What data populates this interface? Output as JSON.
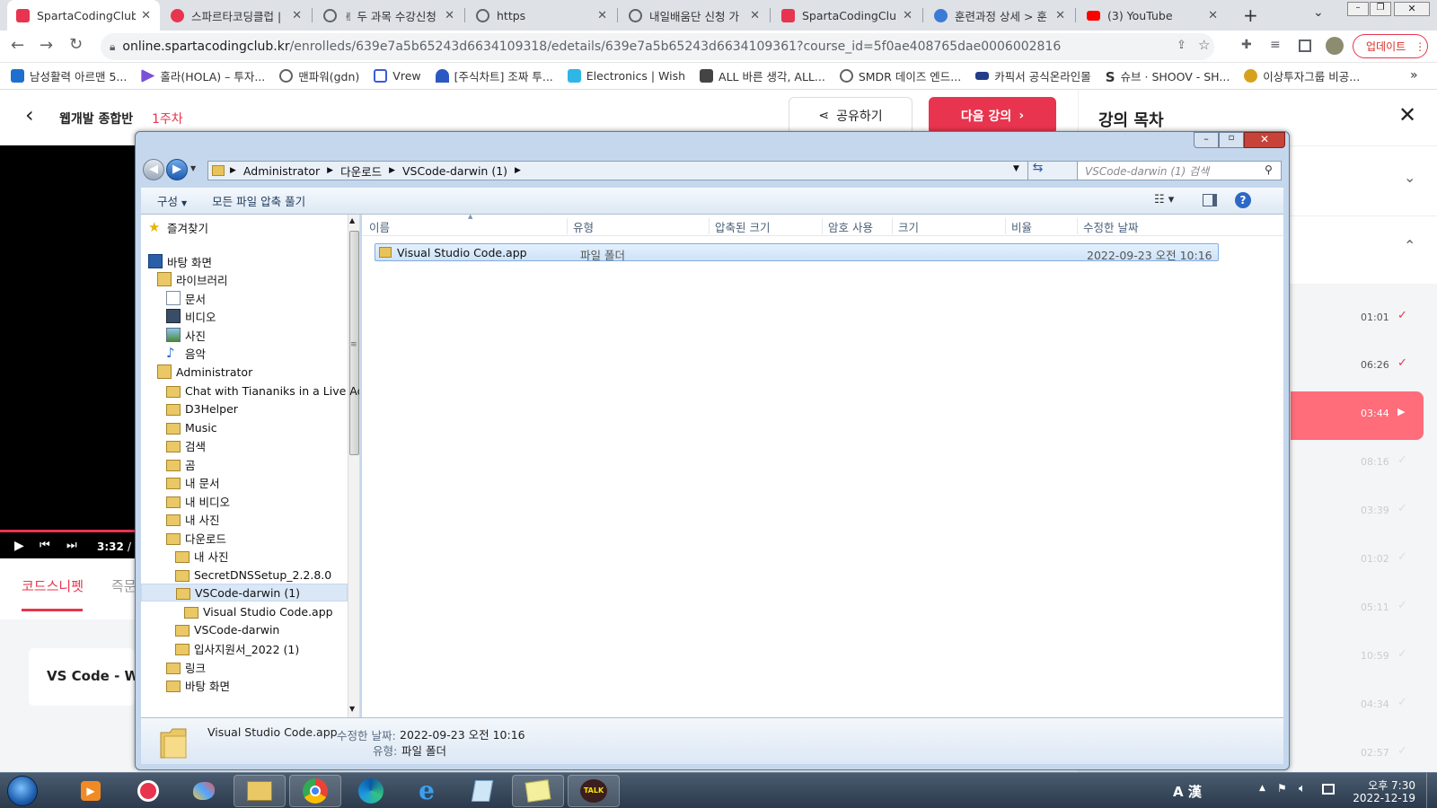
{
  "browser": {
    "tabs": [
      {
        "title": "SpartaCodingClub",
        "favicon_color": "#e8344e",
        "active": true
      },
      {
        "title": "스파르타코딩클럽 |",
        "favicon_color": "#e8344e"
      },
      {
        "title": "✌ 두 과목 수강신청",
        "favicon_color": "#5f6368"
      },
      {
        "title": "https",
        "favicon_color": "#5f6368"
      },
      {
        "title": "내일배움단 신청 가",
        "favicon_color": "#5f6368"
      },
      {
        "title": "SpartaCodingClub",
        "favicon_color": "#e8344e"
      },
      {
        "title": "훈련과정 상세 > 훈",
        "favicon_color": "#3a7bd5"
      },
      {
        "title": "(3) YouTube",
        "favicon_color": "#ff0000"
      }
    ],
    "new_tab_label": "+",
    "url_domain": "online.spartacodingclub.kr",
    "url_path": "/enrolleds/639e7a5b65243d6634109318/edetails/639e7a5b65243d6634109361?course_id=5f0ae408765dae0006002816",
    "update_label": "업데이트",
    "bookmarks": [
      {
        "label": "남성활력 아르맨 5...",
        "color": "#1f6fd1"
      },
      {
        "label": "홀라(HOLA) – 투자...",
        "color": "#7b4fd8"
      },
      {
        "label": "맨파워(gdn)",
        "color": "#5f6368"
      },
      {
        "label": "Vrew",
        "color": "#3b5bdb"
      },
      {
        "label": "[주식차트] 조짜 투...",
        "color": "#2b59c3"
      },
      {
        "label": "Electronics | Wish",
        "color": "#2fb5e6"
      },
      {
        "label": "ALL 바른 생각, ALL...",
        "color": "#444444"
      },
      {
        "label": "SMDR 데이즈 엔드...",
        "color": "#5f6368"
      },
      {
        "label": "카픽서 공식온라인몰",
        "color": "#233d8a"
      },
      {
        "label": "슈브 · SHOOV - SH...",
        "color": "#111111"
      },
      {
        "label": "이상투자그룹 비공...",
        "color": "#d6a21e"
      }
    ],
    "bookmarks_more": "»"
  },
  "web": {
    "course_title": "웹개발 종합반",
    "week": "1주차",
    "share_label": "공유하기",
    "next_label": "다음 강의",
    "toc_title": "강의 목차",
    "player_time": "3:32",
    "player_sep": "/",
    "tab_snippet": "코드스니펫",
    "tab_question": "즉문",
    "card_title": "VS Code - Wi",
    "lecture_times": [
      "01:01",
      "06:26",
      "03:44",
      "08:16",
      "03:39",
      "01:02",
      "05:11",
      "10:59",
      "04:34",
      "02:57"
    ],
    "accent": "#e8344e"
  },
  "explorer": {
    "breadcrumb": [
      "Administrator",
      "다운로드",
      "VSCode-darwin (1)"
    ],
    "search_placeholder": "VSCode-darwin (1) 검색",
    "organize_label": "구성",
    "extract_label": "모든 파일 압축 풀기",
    "nav_items": [
      {
        "label": "즐겨찾기",
        "icon": "star-icon"
      },
      {
        "label": "바탕 화면",
        "icon": "desktop-icon"
      },
      {
        "label": "라이브러리",
        "icon": "library-icon"
      },
      {
        "label": "문서",
        "icon": "document-icon"
      },
      {
        "label": "비디오",
        "icon": "video-icon"
      },
      {
        "label": "사진",
        "icon": "picture-icon"
      },
      {
        "label": "음악",
        "icon": "music-icon"
      },
      {
        "label": "Administrator",
        "icon": "user-folder-icon"
      },
      {
        "label": "Chat with Tiananiks in a Live Adi",
        "icon": "folder-icon"
      },
      {
        "label": "D3Helper",
        "icon": "folder-icon"
      },
      {
        "label": "Music",
        "icon": "folder-icon"
      },
      {
        "label": "검색",
        "icon": "folder-icon"
      },
      {
        "label": "곰",
        "icon": "folder-icon"
      },
      {
        "label": "내 문서",
        "icon": "folder-icon"
      },
      {
        "label": "내 비디오",
        "icon": "folder-icon"
      },
      {
        "label": "내 사진",
        "icon": "folder-icon"
      },
      {
        "label": "다운로드",
        "icon": "folder-icon"
      },
      {
        "label": "내 사진",
        "icon": "folder-icon"
      },
      {
        "label": "SecretDNSSetup_2.2.8.0",
        "icon": "folder-icon"
      },
      {
        "label": "VSCode-darwin (1)",
        "icon": "folder-icon",
        "selected": true
      },
      {
        "label": "Visual Studio Code.app",
        "icon": "folder-icon"
      },
      {
        "label": "VSCode-darwin",
        "icon": "folder-icon"
      },
      {
        "label": "입사지원서_2022 (1)",
        "icon": "folder-icon"
      },
      {
        "label": "링크",
        "icon": "folder-icon"
      },
      {
        "label": "바탕 화면",
        "icon": "folder-icon"
      }
    ],
    "columns": [
      "이름",
      "유형",
      "압축된 크기",
      "암호 사용",
      "크기",
      "비율",
      "수정한 날짜"
    ],
    "rows": [
      {
        "name": "Visual Studio Code.app",
        "type": "파일 폴더",
        "modified": "2022-09-23 오전 10:16"
      }
    ],
    "detail": {
      "name": "Visual Studio Code.app",
      "modified_label": "수정한 날짜:",
      "modified": "2022-09-23 오전 10:16",
      "type_label": "유형:",
      "type": "파일 폴더"
    }
  },
  "taskbar": {
    "apps": [
      "start-orb",
      "media-player",
      "potplayer",
      "paint",
      "explorer",
      "chrome",
      "edge",
      "internet-explorer",
      "notepad",
      "sticky-notes",
      "kakaotalk"
    ],
    "kakao_label": "TALK",
    "ime": "A 漢",
    "time": "오후 7:30",
    "date": "2022-12-19"
  }
}
